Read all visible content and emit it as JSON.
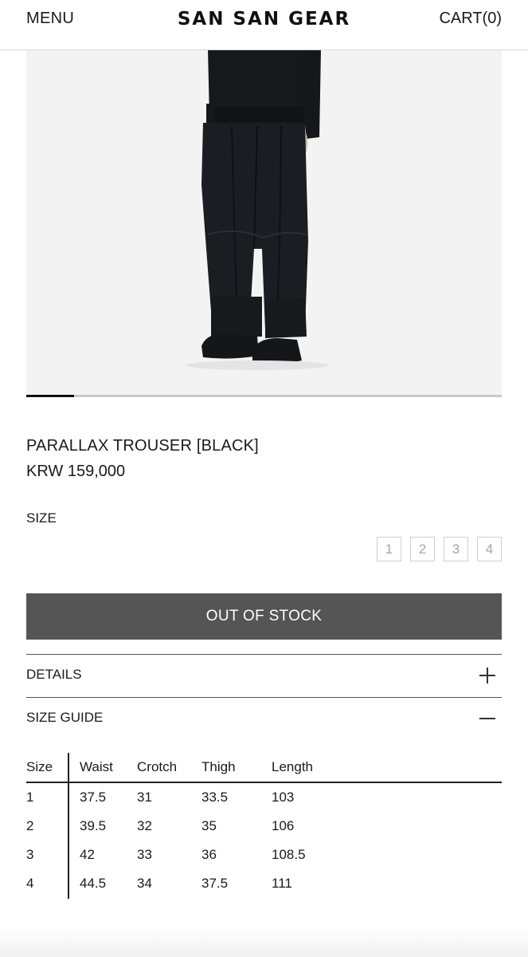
{
  "header": {
    "menu_label": "MENU",
    "brand": "SAN SAN GEAR",
    "cart_label": "CART(0)"
  },
  "carousel": {
    "current_index": 1,
    "total_images": 10,
    "progress_fraction": 0.1
  },
  "product": {
    "name": "PARALLAX TROUSER [BLACK]",
    "price": "KRW 159,000",
    "size_label": "SIZE",
    "sizes": [
      "1",
      "2",
      "3",
      "4"
    ],
    "button_label": "OUT OF STOCK"
  },
  "accordion": {
    "details": {
      "title": "DETAILS",
      "icon": "plus-icon",
      "expanded": false
    },
    "size_guide": {
      "title": "SIZE GUIDE",
      "icon": "minus-icon",
      "expanded": true
    }
  },
  "size_guide_table": {
    "headers": [
      "Size",
      "Waist",
      "Crotch",
      "Thigh",
      "Length"
    ],
    "rows": [
      [
        "1",
        "37.5",
        "31",
        "33.5",
        "103"
      ],
      [
        "2",
        "39.5",
        "32",
        "35",
        "106"
      ],
      [
        "3",
        "42",
        "33",
        "36",
        "108.5"
      ],
      [
        "4",
        "44.5",
        "34",
        "37.5",
        "111"
      ]
    ]
  },
  "colors": {
    "button_bg": "#555555",
    "text": "#1a1a1a",
    "image_bg": "#f3f3f3"
  }
}
